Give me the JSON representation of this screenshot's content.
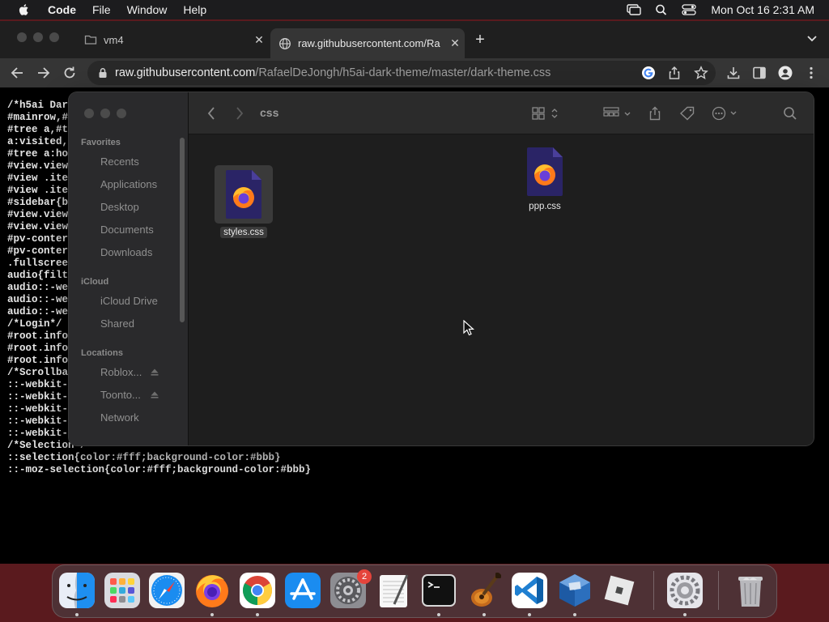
{
  "menubar": {
    "app_name": "Code",
    "items": [
      "File",
      "Window",
      "Help"
    ],
    "clock": "Mon Oct 16  2:31 AM",
    "status_icons": [
      "screen-mirroring-icon",
      "search-icon",
      "control-center-icon"
    ]
  },
  "browser": {
    "tabs": [
      {
        "title": "vm4",
        "active": false
      },
      {
        "title": "raw.githubusercontent.com/Ra",
        "active": true
      }
    ],
    "new_tab": "+",
    "url_host": "raw.githubusercontent.com",
    "url_path": "/RafaelDeJongh/h5ai-dark-theme/master/dark-theme.css"
  },
  "page": {
    "code_lines": [
      "/*h5ai Dar",
      "#mainrow,#",
      "#tree a,#t",
      "a:visited,",
      "#tree a:ho",
      "#view.view",
      "#view .ite",
      "#view .ite",
      "#sidebar{b",
      "#view.view",
      "#view.view",
      "#pv-conter",
      "#pv-conter",
      ".fullscree",
      "audio{filt",
      "audio::-we",
      "audio::-we",
      "audio::-we",
      "/*Login*/",
      "#root.info",
      "#root.info",
      "#root.info",
      "/*Scrollba",
      "::-webkit-",
      "::-webkit-",
      "::-webkit-",
      "::-webkit-",
      "::-webkit-",
      "/*Selection*/",
      "::selection{color:#fff;background-color:#bbb}",
      "::-moz-selection{color:#fff;background-color:#bbb}"
    ]
  },
  "finder": {
    "path_title": "css",
    "sidebar": {
      "favorites_header": "Favorites",
      "favorites": [
        "Recents",
        "Applications",
        "Desktop",
        "Documents",
        "Downloads"
      ],
      "icloud_header": "iCloud",
      "icloud": [
        "iCloud Drive",
        "Shared"
      ],
      "locations_header": "Locations",
      "locations": [
        "Roblox...",
        "Toonto...",
        "Network"
      ]
    },
    "files": [
      {
        "name": "styles.css",
        "selected": true
      },
      {
        "name": "ppp.css",
        "selected": false
      }
    ]
  },
  "dock": {
    "apps": [
      "Finder",
      "Launchpad",
      "Safari",
      "Firefox",
      "Google Chrome",
      "App Store",
      "System Preferences",
      "TextEdit",
      "Terminal",
      "GarageBand",
      "Visual Studio Code",
      "VirtualBox",
      "Roblox",
      "System Settings",
      "Trash"
    ],
    "badge_count": "2"
  },
  "colors": {
    "desktop": "#5a1a1e",
    "menubar": "#1c1c1e",
    "finder_bg": "#1e1e1e",
    "badge": "#e5443b"
  }
}
